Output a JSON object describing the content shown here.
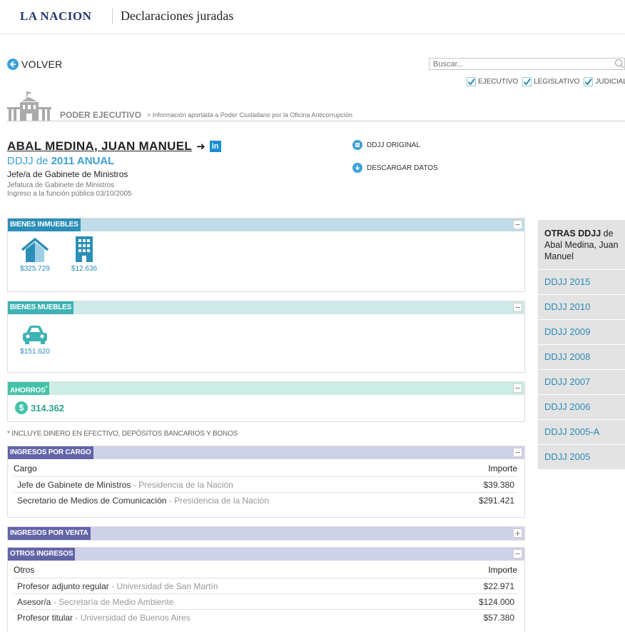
{
  "header": {
    "brand": "LA NACION",
    "site_title": "Declaraciones juradas"
  },
  "nav": {
    "volver_label": "VOLVER"
  },
  "search": {
    "placeholder": "Buscar...",
    "value": "Buscar..."
  },
  "filters": [
    {
      "label": "EJECUTIVO",
      "checked": true
    },
    {
      "label": "LEGISLATIVO",
      "checked": true
    },
    {
      "label": "JUDICIAL",
      "checked": true
    }
  ],
  "poder": {
    "title": "PODER EJECUTIVO",
    "subtitle": "> Información aportada a Poder Ciudadano por la Oficina Anticorrupción"
  },
  "person": {
    "name": "ABAL MEDINA, JUAN MANUEL",
    "ddjj_prefix": "DDJJ de",
    "ddjj_year": "2011 ANUAL",
    "cargo": "Jefe/a de Gabinete de Ministros",
    "organismo": "Jefatura de Gabinete de Ministros",
    "ingreso": "Ingreso a la función pública 03/10/2005"
  },
  "doc_links": {
    "original": "DDJJ ORIGINAL",
    "descargar": "DESCARGAR DATOS"
  },
  "bienes_inmuebles": {
    "title": "BIENES INMUEBLES",
    "items": [
      {
        "icon": "house-icon",
        "value": "$325.729"
      },
      {
        "icon": "building-icon",
        "value": "$12.636"
      }
    ]
  },
  "bienes_muebles": {
    "title": "BIENES MUEBLES",
    "items": [
      {
        "icon": "car-icon",
        "value": "$151.620"
      }
    ]
  },
  "ahorros": {
    "title": "AHORROS",
    "mark": "*",
    "value": "314.362"
  },
  "nota": "* INCLUYE DINERO EN EFECTIVO, DEPÓSITOS BANCARIOS Y BONOS",
  "ingresos_cargo": {
    "title": "INGRESOS POR CARGO",
    "col_left": "Cargo",
    "col_right": "Importe",
    "rows": [
      {
        "cargo": "Jefe de Gabinete de Ministros",
        "inst": " - Presidencia de la Nación",
        "importe": "$39.380"
      },
      {
        "cargo": "Secretario de Medios de Comunicación",
        "inst": " - Presidencia de la Nación",
        "importe": "$291.421"
      }
    ]
  },
  "ingresos_venta": {
    "title": "INGRESOS POR VENTA"
  },
  "otros_ingresos": {
    "title": "OTROS INGRESOS",
    "col_left": "Otros",
    "col_right": "Importe",
    "rows": [
      {
        "cargo": "Profesor adjunto regular",
        "inst": " - Universidad de San Martín",
        "importe": "$22.971"
      },
      {
        "cargo": "Asesor/a",
        "inst": " - Secretaría de Medio Ambiente",
        "importe": "$124.000"
      },
      {
        "cargo": "Profesor titular",
        "inst": " - Universidad de Buenos Aires",
        "importe": "$57.380"
      }
    ]
  },
  "sidebar": {
    "title_bold": "OTRAS DDJJ",
    "title_rest": " de Abal Medina, Juan Manuel",
    "items": [
      "DDJJ 2015",
      "DDJJ 2010",
      "DDJJ 2009",
      "DDJJ 2008",
      "DDJJ 2007",
      "DDJJ 2006",
      "DDJJ 2005-A",
      "DDJJ 2005"
    ]
  },
  "colors": {
    "accent": "#3aa0d8",
    "inmuebles": "#2c8fb8",
    "muebles": "#3fb3b4",
    "ahorros": "#43c2a8",
    "ingresos": "#6264a8"
  }
}
